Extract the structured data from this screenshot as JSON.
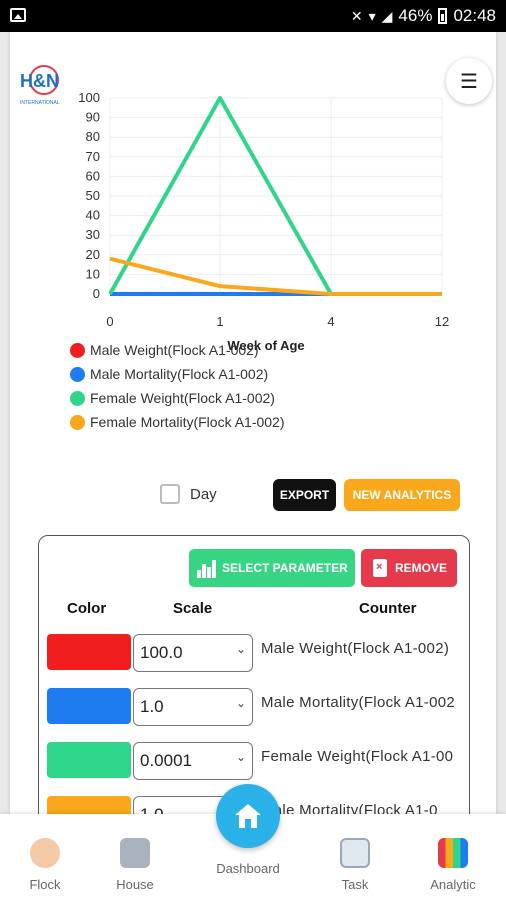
{
  "status_bar": {
    "battery": "46%",
    "time": "02:48"
  },
  "app": {
    "logo_text": "H&N",
    "logo_sub": "INTERNATIONAL"
  },
  "menu": {
    "icon": "hamburger-icon"
  },
  "chart_data": {
    "type": "line",
    "categories": [
      "0",
      "1",
      "4",
      "12"
    ],
    "xlabel": "Week of Age",
    "ylabel": "",
    "ylim": [
      0,
      100
    ],
    "yticks": [
      0,
      10,
      20,
      30,
      40,
      50,
      60,
      70,
      80,
      90,
      100
    ],
    "grid": true,
    "series": [
      {
        "name": "Male Weight(Flock A1-002)",
        "color": "#f01e1e",
        "values": [
          0,
          0,
          0,
          0
        ]
      },
      {
        "name": "Male Mortality(Flock A1-002)",
        "color": "#1e7cf0",
        "values": [
          0,
          0,
          0,
          0
        ]
      },
      {
        "name": "Female Weight(Flock A1-002)",
        "color": "#2ed58a",
        "values": [
          0,
          100,
          0,
          0
        ]
      },
      {
        "name": "Female Mortality(Flock A1-002)",
        "color": "#f8a81a",
        "values": [
          18,
          4,
          0,
          0
        ]
      }
    ]
  },
  "legend": [
    {
      "label": "Male Weight(Flock A1-002)",
      "color": "#f01e1e"
    },
    {
      "label": "Male Mortality(Flock A1-002)",
      "color": "#1e7cf0"
    },
    {
      "label": "Female Weight(Flock A1-002)",
      "color": "#2ed58a"
    },
    {
      "label": "Female Mortality(Flock A1-002)",
      "color": "#f8a81a"
    }
  ],
  "controls": {
    "day_label": "Day",
    "export_label": "EXPORT",
    "new_analytics_label": "NEW ANALYTICS"
  },
  "param_panel": {
    "select_label": "SELECT PARAMETER",
    "remove_label": "REMOVE",
    "headers": {
      "color": "Color",
      "scale": "Scale",
      "counter": "Counter"
    },
    "rows": [
      {
        "color": "#f01e1e",
        "scale": "100.0",
        "counter": "Male Weight(Flock A1-002)"
      },
      {
        "color": "#1e7cf0",
        "scale": "1.0",
        "counter": "Male Mortality(Flock A1-002"
      },
      {
        "color": "#2ed58a",
        "scale": "0.0001",
        "counter": "Female Weight(Flock A1-00"
      },
      {
        "color": "#f8a81a",
        "scale": "1.0",
        "counter": "male Mortality(Flock A1-0"
      }
    ]
  },
  "nav": {
    "flock": "Flock",
    "house": "House",
    "dashboard": "Dashboard",
    "task": "Task",
    "analytic": "Analytic"
  }
}
